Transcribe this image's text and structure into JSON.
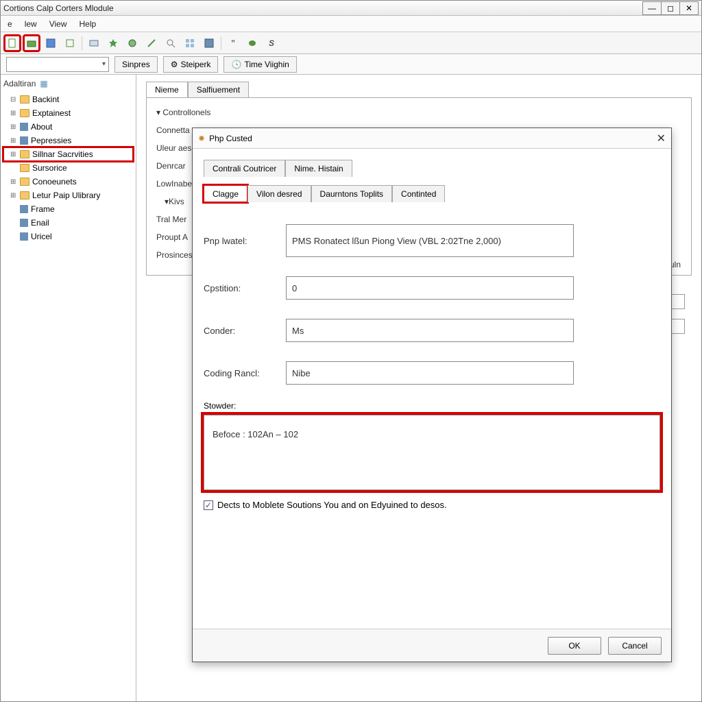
{
  "window": {
    "title": "Cortions Calp Corters Mlodule"
  },
  "menu": {
    "items": [
      "e",
      "lew",
      "View",
      "Help"
    ]
  },
  "toolbar_icons": [
    "doc",
    "open",
    "save",
    "cut",
    "copy",
    "paste",
    "star",
    "gear",
    "wand",
    "find",
    "grid",
    "disk",
    "dash",
    "quote",
    "blob",
    "letters"
  ],
  "subbar": {
    "tabs": [
      "Sinpres",
      "Steiperk",
      "Time Viighin"
    ]
  },
  "sidebar": {
    "header": "Adaltiran",
    "items": [
      {
        "label": "Backint",
        "icon": "folder",
        "exp": "-"
      },
      {
        "label": "Exptainest",
        "icon": "folder",
        "exp": "+"
      },
      {
        "label": "About",
        "icon": "node",
        "exp": "+"
      },
      {
        "label": "Pepressies",
        "icon": "node",
        "exp": "+"
      },
      {
        "label": "Sillnar Sacrvities",
        "icon": "folder",
        "exp": "+",
        "hl": true
      },
      {
        "label": "Sursorice",
        "icon": "folder",
        "exp": ""
      },
      {
        "label": "Conoeunets",
        "icon": "folder",
        "exp": "+"
      },
      {
        "label": "Letur Paip Ulibrary",
        "icon": "folder",
        "exp": "+"
      },
      {
        "label": "Frame",
        "icon": "node",
        "exp": ""
      },
      {
        "label": "Enail",
        "icon": "node",
        "exp": ""
      },
      {
        "label": "Uricel",
        "icon": "node",
        "exp": ""
      }
    ]
  },
  "main": {
    "tabs": [
      "Nieme",
      "Salfiuement"
    ],
    "section": "Controllonels",
    "rows": [
      "Connetta",
      "Uleur aes",
      "Denrcar",
      "LowInabe",
      "Kivs",
      "Tral Mer",
      "Proupt A",
      "Prosinces"
    ],
    "right_label": "eduln"
  },
  "dialog": {
    "title": "Php Custed",
    "tabs1": [
      "Contrali Coutricer",
      "Nime. Histain"
    ],
    "tabs2": [
      "Clagge",
      "Vilon desred",
      "Daurntons Toplits",
      "Continted"
    ],
    "fields": {
      "pnp_label": "Pnp lwatel:",
      "pnp_value": "PMS Ronatect lßun Piong View (VBL 2:02Tne 2,000)",
      "cpstition_label": "Cpstition:",
      "cpstition_value": "0",
      "conder_label": "Conder:",
      "conder_value": "Ms",
      "coding_label": "Coding Rancl:",
      "coding_value": "Nibe",
      "stowder_label": "Stowder:",
      "stowder_value": "Befoce : 102An – 102"
    },
    "checkbox_label": "Dects to Moblete Soutions You and on Edyuined to desos.",
    "ok": "OK",
    "cancel": "Cancel"
  }
}
